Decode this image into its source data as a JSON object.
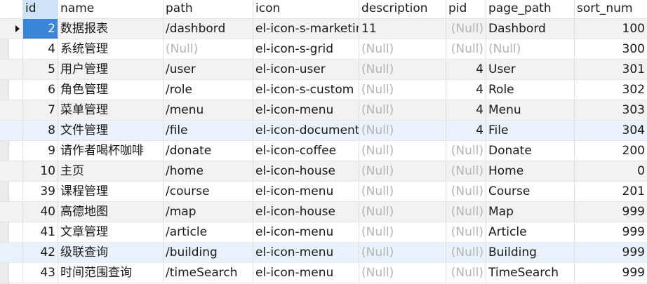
{
  "columns": [
    "id",
    "name",
    "path",
    "icon",
    "description",
    "pid",
    "page_path",
    "sort_num"
  ],
  "rows": [
    {
      "id": "2",
      "name": "数据报表",
      "path": "/dashbord",
      "icon": "el-icon-s-marketin",
      "description": "11",
      "pid": "(Null)",
      "page_path": "Dashbord",
      "sort_num": "100"
    },
    {
      "id": "4",
      "name": "系统管理",
      "path": "(Null)",
      "icon": "el-icon-s-grid",
      "description": "(Null)",
      "pid": "(Null)",
      "page_path": "(Null)",
      "sort_num": "300"
    },
    {
      "id": "5",
      "name": "用户管理",
      "path": "/user",
      "icon": "el-icon-user",
      "description": "(Null)",
      "pid": "4",
      "page_path": "User",
      "sort_num": "301"
    },
    {
      "id": "6",
      "name": "角色管理",
      "path": "/role",
      "icon": "el-icon-s-custom",
      "description": "(Null)",
      "pid": "4",
      "page_path": "Role",
      "sort_num": "302"
    },
    {
      "id": "7",
      "name": "菜单管理",
      "path": "/menu",
      "icon": "el-icon-menu",
      "description": "(Null)",
      "pid": "4",
      "page_path": "Menu",
      "sort_num": "303"
    },
    {
      "id": "8",
      "name": "文件管理",
      "path": "/file",
      "icon": "el-icon-document",
      "description": "(Null)",
      "pid": "4",
      "page_path": "File",
      "sort_num": "304"
    },
    {
      "id": "9",
      "name": "请作者喝杯咖啡",
      "path": "/donate",
      "icon": "el-icon-coffee",
      "description": "(Null)",
      "pid": "(Null)",
      "page_path": "Donate",
      "sort_num": "200"
    },
    {
      "id": "10",
      "name": "主页",
      "path": "/home",
      "icon": "el-icon-house",
      "description": "(Null)",
      "pid": "(Null)",
      "page_path": "Home",
      "sort_num": "0"
    },
    {
      "id": "39",
      "name": "课程管理",
      "path": "/course",
      "icon": "el-icon-menu",
      "description": "(Null)",
      "pid": "(Null)",
      "page_path": "Course",
      "sort_num": "201"
    },
    {
      "id": "40",
      "name": "高德地图",
      "path": "/map",
      "icon": "el-icon-house",
      "description": "(Null)",
      "pid": "(Null)",
      "page_path": "Map",
      "sort_num": "999"
    },
    {
      "id": "41",
      "name": "文章管理",
      "path": "/article",
      "icon": "el-icon-menu",
      "description": "(Null)",
      "pid": "(Null)",
      "page_path": "Article",
      "sort_num": "999"
    },
    {
      "id": "42",
      "name": "级联查询",
      "path": "/building",
      "icon": "el-icon-menu",
      "description": "(Null)",
      "pid": "(Null)",
      "page_path": "Building",
      "sort_num": "999"
    },
    {
      "id": "43",
      "name": "时间范围查询",
      "path": "/timeSearch",
      "icon": "el-icon-menu",
      "description": "(Null)",
      "pid": "(Null)",
      "page_path": "TimeSearch",
      "sort_num": "999"
    }
  ]
}
